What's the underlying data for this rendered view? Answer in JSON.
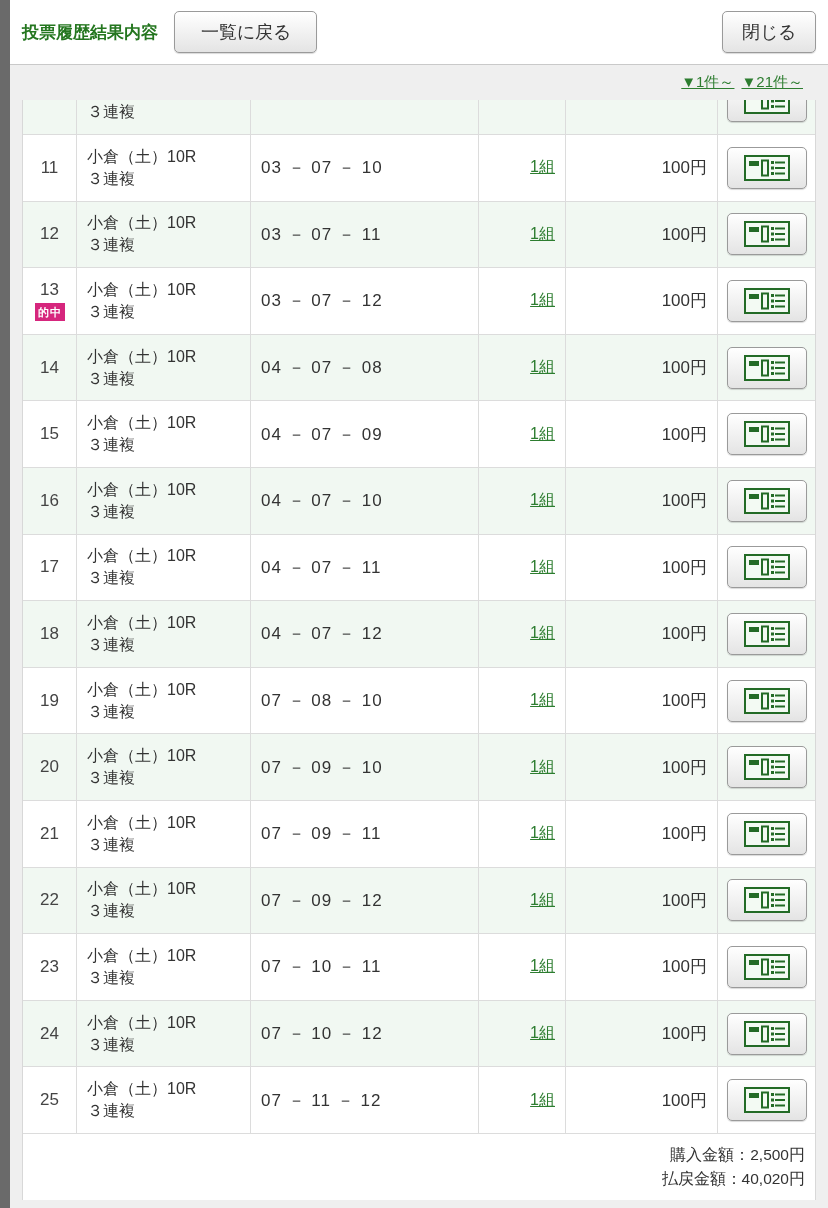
{
  "header": {
    "title": "投票履歴結果内容",
    "back_button": "一覧に戻る",
    "close_button": "閉じる"
  },
  "pager_links": [
    "▼1件～",
    "▼21件～"
  ],
  "bets": [
    {
      "bet_type": "３連複"
    },
    {
      "no": "11",
      "race": "小倉（土）10R",
      "bet_type": "３連複",
      "combination": "03 － 07 － 10",
      "count": "1組",
      "amount": "100円"
    },
    {
      "no": "12",
      "race": "小倉（土）10R",
      "bet_type": "３連複",
      "combination": "03 － 07 － 11",
      "count": "1組",
      "amount": "100円"
    },
    {
      "no": "13",
      "badge": "的中",
      "race": "小倉（土）10R",
      "bet_type": "３連複",
      "combination": "03 － 07 － 12",
      "count": "1組",
      "amount": "100円"
    },
    {
      "no": "14",
      "race": "小倉（土）10R",
      "bet_type": "３連複",
      "combination": "04 － 07 － 08",
      "count": "1組",
      "amount": "100円"
    },
    {
      "no": "15",
      "race": "小倉（土）10R",
      "bet_type": "３連複",
      "combination": "04 － 07 － 09",
      "count": "1組",
      "amount": "100円"
    },
    {
      "no": "16",
      "race": "小倉（土）10R",
      "bet_type": "３連複",
      "combination": "04 － 07 － 10",
      "count": "1組",
      "amount": "100円"
    },
    {
      "no": "17",
      "race": "小倉（土）10R",
      "bet_type": "３連複",
      "combination": "04 － 07 － 11",
      "count": "1組",
      "amount": "100円"
    },
    {
      "no": "18",
      "race": "小倉（土）10R",
      "bet_type": "３連複",
      "combination": "04 － 07 － 12",
      "count": "1組",
      "amount": "100円"
    },
    {
      "no": "19",
      "race": "小倉（土）10R",
      "bet_type": "３連複",
      "combination": "07 － 08 － 10",
      "count": "1組",
      "amount": "100円"
    },
    {
      "no": "20",
      "race": "小倉（土）10R",
      "bet_type": "３連複",
      "combination": "07 － 09 － 10",
      "count": "1組",
      "amount": "100円"
    },
    {
      "no": "21",
      "race": "小倉（土）10R",
      "bet_type": "３連複",
      "combination": "07 － 09 － 11",
      "count": "1組",
      "amount": "100円"
    },
    {
      "no": "22",
      "race": "小倉（土）10R",
      "bet_type": "３連複",
      "combination": "07 － 09 － 12",
      "count": "1組",
      "amount": "100円"
    },
    {
      "no": "23",
      "race": "小倉（土）10R",
      "bet_type": "３連複",
      "combination": "07 － 10 － 11",
      "count": "1組",
      "amount": "100円"
    },
    {
      "no": "24",
      "race": "小倉（土）10R",
      "bet_type": "３連複",
      "combination": "07 － 10 － 12",
      "count": "1組",
      "amount": "100円"
    },
    {
      "no": "25",
      "race": "小倉（土）10R",
      "bet_type": "３連複",
      "combination": "07 － 11 － 12",
      "count": "1組",
      "amount": "100円"
    }
  ],
  "totals": [
    "購入金額：2,500円",
    "払戻金額：40,020円"
  ]
}
